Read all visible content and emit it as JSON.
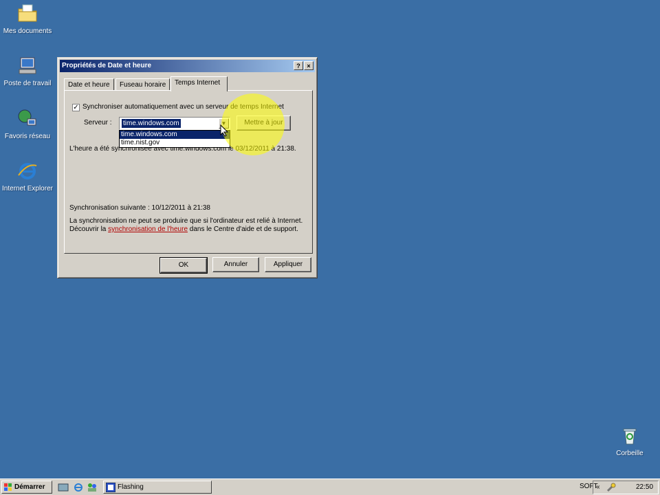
{
  "desktop": {
    "icons": [
      {
        "label": "Mes documents"
      },
      {
        "label": "Poste de travail"
      },
      {
        "label": "Favoris réseau"
      },
      {
        "label": "Internet Explorer"
      },
      {
        "label": "Corbeille"
      }
    ]
  },
  "dialog": {
    "title": "Propriétés de Date et heure",
    "help_btn": "?",
    "close_btn": "×",
    "tabs": [
      {
        "label": "Date et heure"
      },
      {
        "label": "Fuseau horaire"
      },
      {
        "label": "Temps Internet",
        "active": true
      }
    ],
    "sync_checkbox_label": "Synchroniser automatiquement avec un serveur de temps Internet",
    "sync_checked": true,
    "server_label": "Serveur :",
    "server_value": "time.windows.com",
    "server_options": [
      "time.windows.com",
      "time.nist.gov"
    ],
    "update_btn": "Mettre à jour",
    "last_sync": "L'heure a été synchronisée avec time.windows.com le 03/12/2011 à 21:38.",
    "next_sync": "Synchronisation suivante : 10/12/2011 à 21:38",
    "note_part1": "La synchronisation ne peut se produire que si l'ordinateur est relié à Internet. Découvrir la ",
    "note_link": "synchronisation de l'heure",
    "note_part2": " dans le Centre d'aide et de support.",
    "ok_btn": "OK",
    "cancel_btn": "Annuler",
    "apply_btn": "Appliquer"
  },
  "taskbar": {
    "start_label": "Démarrer",
    "task_label": "Flashing",
    "lang": "SOFT",
    "clock": "22:50",
    "tray_arrow": "«"
  },
  "colors": {
    "desktop": "#3A6EA5",
    "title_start": "#0A246A",
    "face": "#D4D0C8",
    "link": "#B00000"
  }
}
